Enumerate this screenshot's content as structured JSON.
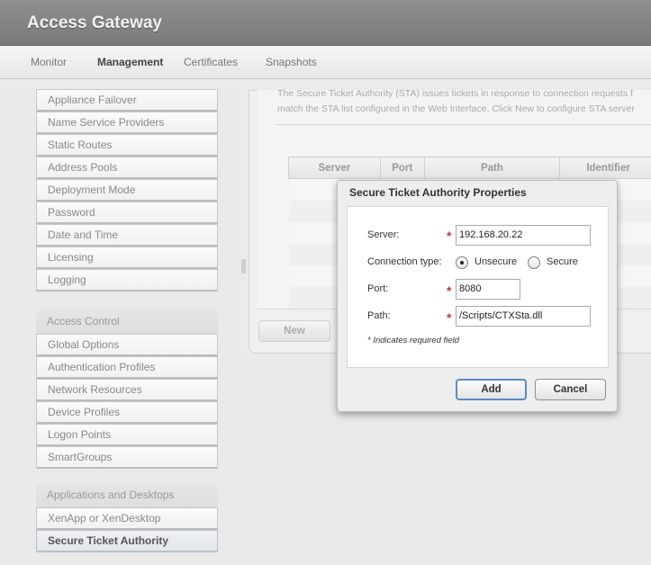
{
  "app": {
    "title": "Access Gateway"
  },
  "nav": {
    "items": [
      "Monitor",
      "Management",
      "Certificates",
      "Snapshots"
    ],
    "active": "Management"
  },
  "sidebar": {
    "group1_items": [
      "Appliance Failover",
      "Name Service Providers",
      "Static Routes",
      "Address Pools",
      "Deployment Mode",
      "Password",
      "Date and Time",
      "Licensing",
      "Logging"
    ],
    "access_control": {
      "header": "Access Control",
      "items": [
        "Global Options",
        "Authentication Profiles",
        "Network Resources",
        "Device Profiles",
        "Logon Points",
        "SmartGroups"
      ]
    },
    "apps_desktops": {
      "header": "Applications and Desktops",
      "items": [
        "XenApp or XenDesktop",
        "Secure Ticket Authority"
      ],
      "selected": "Secure Ticket Authority"
    }
  },
  "main": {
    "description_line1": "The Secure Ticket Authority (STA) issues tickets in response to connection requests f",
    "description_line2": "match the STA list configured in the Web Interface. Click New to configure STA server",
    "table_headers": [
      "Server",
      "Port",
      "Path",
      "Identifier"
    ],
    "new_button": "New"
  },
  "dialog": {
    "title": "Secure Ticket Authority Properties",
    "server_label": "Server:",
    "server_value": "192.168.20.22",
    "connection_type_label": "Connection type:",
    "unsecure_label": "Unsecure",
    "secure_label": "Secure",
    "connection_type_selected": "Unsecure",
    "port_label": "Port:",
    "port_value": "8080",
    "path_label": "Path:",
    "path_value": "/Scripts/CTXSta.dll",
    "required_marker": "*",
    "required_note": "* Indicates required field",
    "add_button": "Add",
    "cancel_button": "Cancel"
  }
}
